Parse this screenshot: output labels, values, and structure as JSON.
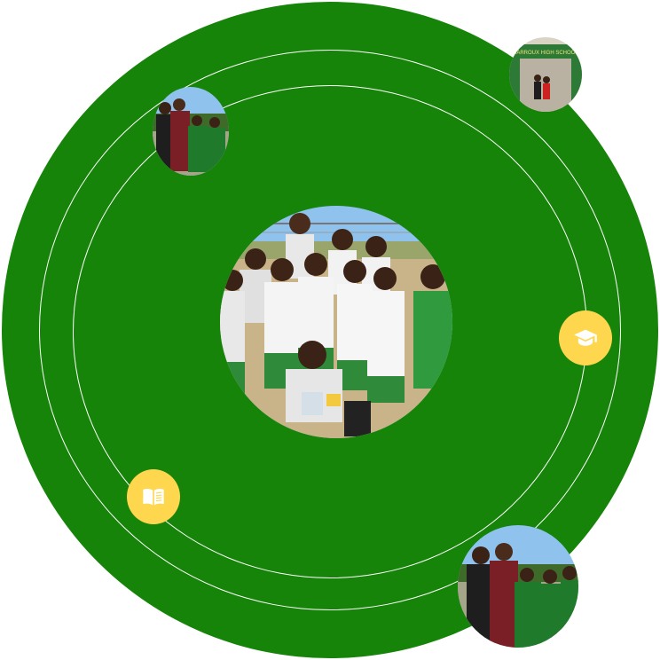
{
  "colors": {
    "circle": "#168309",
    "ring": "#ffffff",
    "badge": "#ffd74f",
    "badge_icon": "#ffffff",
    "uniform_green": "#1f7a2b",
    "sky": "#8fc3ee"
  },
  "photos": [
    {
      "name": "team-photo",
      "subject": "team group photo"
    },
    {
      "name": "officials-students-photo",
      "subject": "officials with students"
    },
    {
      "name": "school-gate-photo",
      "subject": "school entrance gate"
    },
    {
      "name": "officials-students-photo-large",
      "subject": "officials with students"
    }
  ],
  "gate_sign": "BARROUX HIGH SCHOOL",
  "badges": [
    {
      "icon": "graduation-cap-icon"
    },
    {
      "icon": "open-book-icon"
    }
  ]
}
